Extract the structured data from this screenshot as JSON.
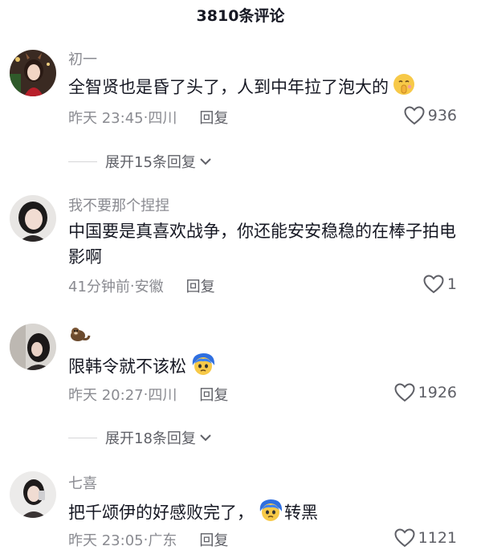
{
  "header": {
    "title": "3810条评论"
  },
  "comments": [
    {
      "username": "初一",
      "text": "全智贤也是昏了头了，人到中年拉了泡大的",
      "emoji": "shushing-face",
      "time": "昨天 23:45",
      "location": "四川",
      "reply_label": "回复",
      "likes": "936",
      "expand_label": "展开15条回复"
    },
    {
      "username": "我不要那个捏捏",
      "text": "中国要是真喜欢战争，你还能安安稳稳的在棒子拍电影啊",
      "time": "41分钟前",
      "location": "安徽",
      "reply_label": "回复",
      "likes": "1"
    },
    {
      "username": "",
      "username_emoji": "otter",
      "text": "限韩令就不该松",
      "emoji": "blue-hair-face",
      "time": "昨天 20:27",
      "location": "四川",
      "reply_label": "回复",
      "likes": "1926",
      "expand_label": "展开18条回复"
    },
    {
      "username": "七喜",
      "text_before": "把千颂伊的好感败完了，",
      "emoji": "blue-hair-face",
      "text_after": "转黑",
      "time": "昨天 23:05",
      "location": "广东",
      "reply_label": "回复",
      "likes": "1121"
    }
  ],
  "separator": "·"
}
